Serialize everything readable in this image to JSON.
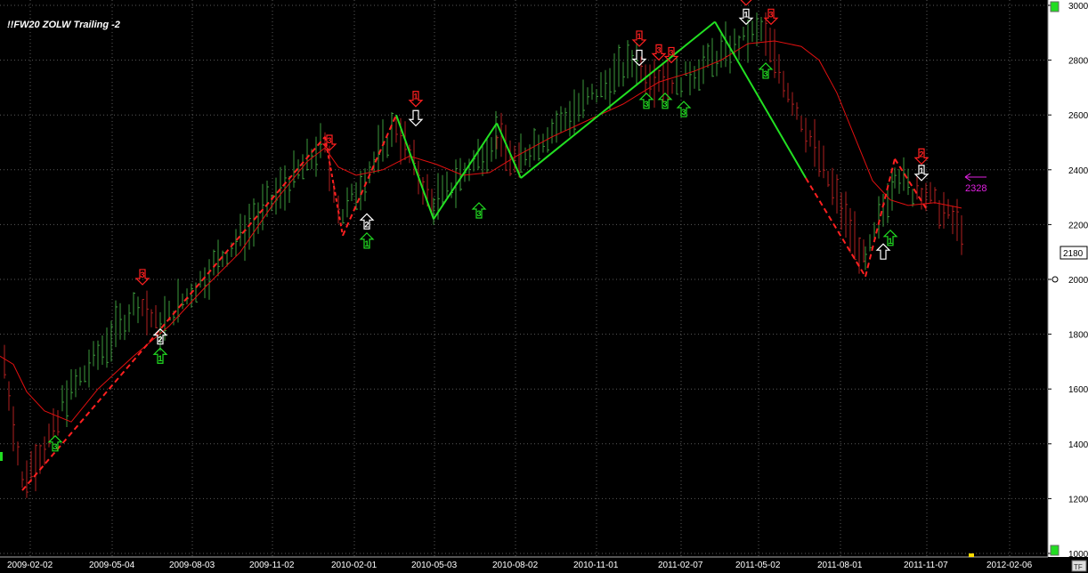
{
  "window": {
    "title": "!!FW20 ZOLW Trailing -2",
    "tf_label": "TF"
  },
  "colors": {
    "background": "#000000",
    "axis_panel": "#ffffff",
    "grid": "#5a5a5a",
    "up_bar": "#3c9a3c",
    "down_bar": "#b02020",
    "ma_line": "#e01010",
    "zigzag_up": "#22e022",
    "zigzag_down": "#ff2020",
    "target": "#e020e0",
    "marker_white": "#ffffff",
    "marker_green": "#22dd22",
    "marker_red": "#ff2020"
  },
  "chart_data": {
    "type": "ohlc",
    "title": "!!FW20 ZOLW Trailing -2",
    "ylim": [
      1000,
      3000
    ],
    "ytick_values": [
      1000,
      1200,
      1400,
      1600,
      1800,
      2000,
      2200,
      2400,
      2600,
      2800,
      3000
    ],
    "ytick_labels": [
      "1000",
      "1200",
      "1400",
      "1600",
      "1800",
      "2000",
      "2200",
      "2400",
      "2600",
      "2800",
      "3000"
    ],
    "xtick_labels": [
      "2009-02-02",
      "2009-05-04",
      "2009-08-03",
      "2009-11-02",
      "2010-02-01",
      "2010-05-03",
      "2010-08-02",
      "2010-11-01",
      "2011-02-07",
      "2011-05-02",
      "2011-08-01",
      "2011-11-07",
      "2012-02-06"
    ],
    "xlim": [
      0,
      1180
    ],
    "last_price": "2180",
    "target_label": "2328",
    "target_value": 2328,
    "zigzag": [
      {
        "x": 25,
        "y": 1230,
        "dir": "down"
      },
      {
        "x": 365,
        "y": 2520,
        "dir": "up"
      },
      {
        "x": 385,
        "y": 2160,
        "dir": "down"
      },
      {
        "x": 445,
        "y": 2600,
        "dir": "up"
      },
      {
        "x": 487,
        "y": 2220,
        "dir": "down"
      },
      {
        "x": 558,
        "y": 2570,
        "dir": "up"
      },
      {
        "x": 585,
        "y": 2370,
        "dir": "down"
      },
      {
        "x": 803,
        "y": 2940,
        "dir": "up"
      },
      {
        "x": 905,
        "y": 2370,
        "dir": "up"
      },
      {
        "x": 972,
        "y": 2010,
        "dir": "down"
      },
      {
        "x": 1005,
        "y": 2440,
        "dir": "up"
      },
      {
        "x": 1040,
        "y": 2260,
        "dir": "down"
      }
    ],
    "ma_line": [
      [
        0,
        1720
      ],
      [
        15,
        1690
      ],
      [
        30,
        1590
      ],
      [
        50,
        1520
      ],
      [
        80,
        1480
      ],
      [
        110,
        1600
      ],
      [
        150,
        1720
      ],
      [
        190,
        1830
      ],
      [
        230,
        1970
      ],
      [
        270,
        2100
      ],
      [
        310,
        2290
      ],
      [
        345,
        2430
      ],
      [
        365,
        2480
      ],
      [
        380,
        2410
      ],
      [
        400,
        2380
      ],
      [
        430,
        2400
      ],
      [
        460,
        2450
      ],
      [
        490,
        2420
      ],
      [
        520,
        2380
      ],
      [
        550,
        2390
      ],
      [
        580,
        2450
      ],
      [
        620,
        2520
      ],
      [
        660,
        2580
      ],
      [
        700,
        2640
      ],
      [
        740,
        2720
      ],
      [
        780,
        2760
      ],
      [
        810,
        2800
      ],
      [
        840,
        2860
      ],
      [
        870,
        2870
      ],
      [
        900,
        2850
      ],
      [
        920,
        2800
      ],
      [
        940,
        2680
      ],
      [
        960,
        2520
      ],
      [
        980,
        2360
      ],
      [
        1000,
        2290
      ],
      [
        1020,
        2270
      ],
      [
        1050,
        2280
      ],
      [
        1080,
        2260
      ]
    ],
    "markers": [
      {
        "x": 160,
        "y": 2010,
        "kind": "down",
        "color": "red",
        "label": "3"
      },
      {
        "x": 180,
        "y": 1790,
        "kind": "up",
        "color": "white",
        "label": "2"
      },
      {
        "x": 180,
        "y": 1720,
        "kind": "up",
        "color": "green",
        "label": "1"
      },
      {
        "x": 62,
        "y": 1400,
        "kind": "up",
        "color": "green",
        "label": "3"
      },
      {
        "x": 370,
        "y": 2500,
        "kind": "down",
        "color": "red",
        "label": "3"
      },
      {
        "x": 412,
        "y": 2210,
        "kind": "up",
        "color": "white",
        "label": "2"
      },
      {
        "x": 412,
        "y": 2140,
        "kind": "up",
        "color": "green",
        "label": "1"
      },
      {
        "x": 467,
        "y": 2660,
        "kind": "down",
        "color": "red",
        "label": "1"
      },
      {
        "x": 467,
        "y": 2590,
        "kind": "down",
        "color": "white",
        "label": ""
      },
      {
        "x": 538,
        "y": 2250,
        "kind": "up",
        "color": "green",
        "label": "3"
      },
      {
        "x": 718,
        "y": 2880,
        "kind": "down",
        "color": "red",
        "label": "1"
      },
      {
        "x": 718,
        "y": 2810,
        "kind": "down",
        "color": "white",
        "label": ""
      },
      {
        "x": 740,
        "y": 2830,
        "kind": "down",
        "color": "red",
        "label": "3"
      },
      {
        "x": 754,
        "y": 2820,
        "kind": "down",
        "color": "red",
        "label": "3"
      },
      {
        "x": 726,
        "y": 2650,
        "kind": "up",
        "color": "green",
        "label": "3"
      },
      {
        "x": 747,
        "y": 2650,
        "kind": "up",
        "color": "green",
        "label": "3"
      },
      {
        "x": 768,
        "y": 2620,
        "kind": "up",
        "color": "green",
        "label": "3"
      },
      {
        "x": 838,
        "y": 3030,
        "kind": "down",
        "color": "red",
        "label": ""
      },
      {
        "x": 838,
        "y": 2960,
        "kind": "down",
        "color": "white",
        "label": "1"
      },
      {
        "x": 866,
        "y": 2960,
        "kind": "down",
        "color": "red",
        "label": "3"
      },
      {
        "x": 860,
        "y": 2760,
        "kind": "up",
        "color": "green",
        "label": "3"
      },
      {
        "x": 1035,
        "y": 2450,
        "kind": "down",
        "color": "red",
        "label": "2"
      },
      {
        "x": 1035,
        "y": 2390,
        "kind": "down",
        "color": "white",
        "label": "1"
      },
      {
        "x": 1000,
        "y": 2150,
        "kind": "up",
        "color": "green",
        "label": "1"
      },
      {
        "x": 992,
        "y": 2100,
        "kind": "up",
        "color": "white",
        "label": ""
      }
    ],
    "bar_segments": [
      {
        "x0": 5,
        "x1": 25,
        "start": 1700,
        "end": 1260,
        "color": "red"
      },
      {
        "x0": 25,
        "x1": 70,
        "start": 1260,
        "end": 1500,
        "color": "red"
      },
      {
        "x0": 70,
        "x1": 160,
        "start": 1550,
        "end": 1940,
        "color": "green"
      },
      {
        "x0": 160,
        "x1": 180,
        "start": 1900,
        "end": 1820,
        "color": "red"
      },
      {
        "x0": 180,
        "x1": 365,
        "start": 1830,
        "end": 2500,
        "color": "green"
      },
      {
        "x0": 365,
        "x1": 385,
        "start": 2480,
        "end": 2200,
        "color": "red"
      },
      {
        "x0": 385,
        "x1": 445,
        "start": 2240,
        "end": 2560,
        "color": "green"
      },
      {
        "x0": 445,
        "x1": 487,
        "start": 2560,
        "end": 2260,
        "color": "red"
      },
      {
        "x0": 487,
        "x1": 558,
        "start": 2270,
        "end": 2520,
        "color": "green"
      },
      {
        "x0": 558,
        "x1": 585,
        "start": 2520,
        "end": 2400,
        "color": "red"
      },
      {
        "x0": 585,
        "x1": 720,
        "start": 2450,
        "end": 2820,
        "color": "green"
      },
      {
        "x0": 720,
        "x1": 760,
        "start": 2760,
        "end": 2720,
        "color": "red"
      },
      {
        "x0": 760,
        "x1": 860,
        "start": 2720,
        "end": 2920,
        "color": "green"
      },
      {
        "x0": 860,
        "x1": 972,
        "start": 2880,
        "end": 2060,
        "color": "red"
      },
      {
        "x0": 972,
        "x1": 1005,
        "start": 2060,
        "end": 2380,
        "color": "green"
      },
      {
        "x0": 1005,
        "x1": 1030,
        "start": 2400,
        "end": 2300,
        "color": "green"
      },
      {
        "x0": 1030,
        "x1": 1085,
        "start": 2340,
        "end": 2170,
        "color": "red"
      }
    ]
  }
}
